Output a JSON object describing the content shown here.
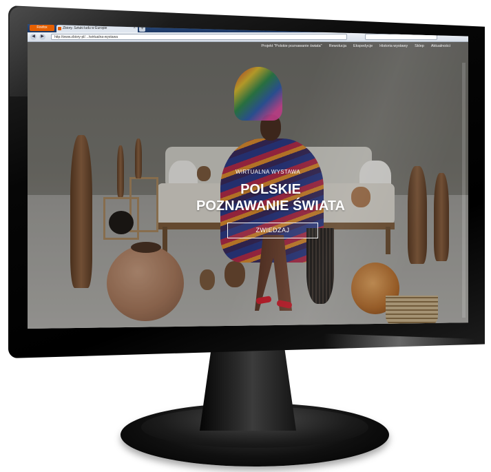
{
  "browser": {
    "menu_button_label": "Firefox",
    "tab_title": "Zbiory. Sztuki ludu w Europie",
    "new_tab_label": "+",
    "tab_close_label": "×",
    "back_label": "◀",
    "forward_label": "▶",
    "url": "http://www.zbiory-pl/…/wirtualna-wystawa",
    "search_placeholder": ""
  },
  "site_nav": {
    "items": [
      {
        "label": "Projekt \"Polskie poznawanie świata\""
      },
      {
        "label": "Rewolucja"
      },
      {
        "label": "Ekspedycje"
      },
      {
        "label": "Historia wystawy"
      },
      {
        "label": "Sklep"
      },
      {
        "label": "Aktualności"
      }
    ]
  },
  "hero": {
    "subtitle": "WIRTUALNA WYSTAWA",
    "title_line1": "POLSKIE",
    "title_line2": "POZNAWANIE ŚWIATA",
    "cta_label": "ZWIEDZAJ"
  },
  "colors": {
    "accent_shoe": "#d01c2a",
    "browser_chrome": "#1d3a67",
    "firefox_button": "#e66000"
  },
  "icons": {
    "back": "arrow-left-icon",
    "forward": "arrow-right-icon",
    "tab_favicon": "firefox-icon"
  }
}
